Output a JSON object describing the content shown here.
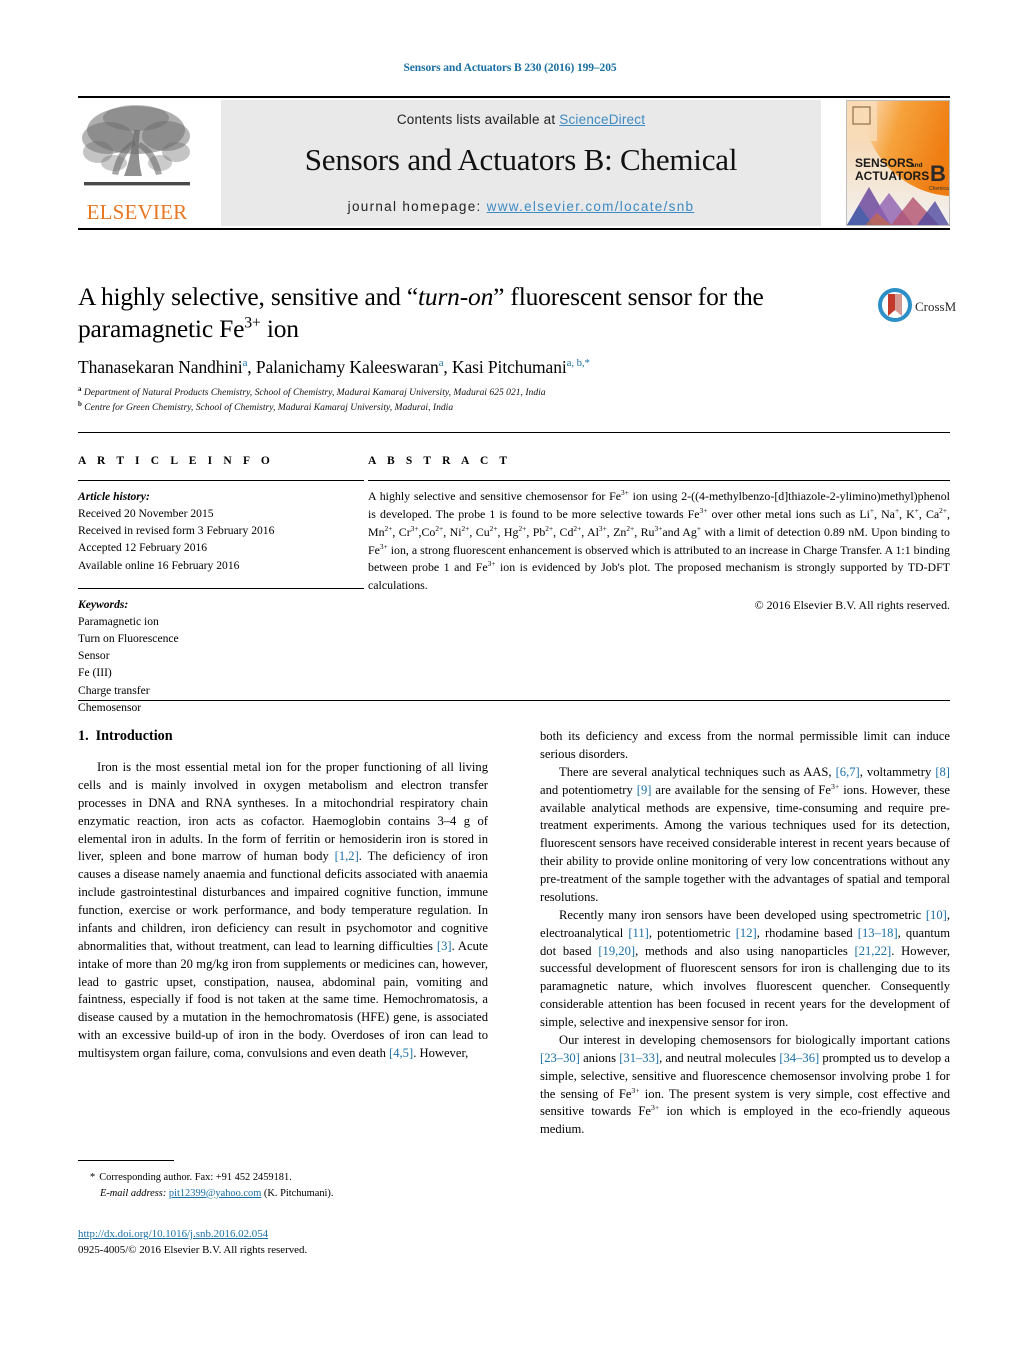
{
  "running_head": "Sensors and Actuators B 230 (2016) 199–205",
  "masthead": {
    "contents_prefix": "Contents lists available at ",
    "sciencedirect": "ScienceDirect",
    "journal_title": "Sensors and Actuators B: Chemical",
    "homepage_prefix": "journal homepage: ",
    "homepage_url": "www.elsevier.com/locate/snb",
    "publisher_wordmark": "ELSEVIER",
    "publisher_logo_name": "elsevier-tree-logo",
    "cover_title_line1": "SENSORS",
    "cover_title_and": "and",
    "cover_title_line2": "ACTUATORS",
    "cover_volume_letter": "B",
    "cover_sub": "Chemical",
    "link_color": "#3D8BC4",
    "brand_orange": "#E87722",
    "band_bg": "#e9e9e9"
  },
  "title": {
    "part1": "A highly selective, sensitive and “",
    "italic": "turn-on",
    "part2": "” fluorescent sensor for the paramagnetic Fe",
    "sup": "3+",
    "part3": " ion"
  },
  "crossmark": {
    "label": "CrossMark",
    "ring_color": "#2d8fc7",
    "inner_color": "#c0392b"
  },
  "authors": [
    {
      "name": "Thanasekaran Nandhini",
      "marks": "a",
      "sep": ", "
    },
    {
      "name": "Palanichamy Kaleeswaran",
      "marks": "a",
      "sep": ", "
    },
    {
      "name": "Kasi Pitchumani",
      "marks": "a, b,",
      "star": "*",
      "sep": ""
    }
  ],
  "affiliations": [
    {
      "mark": "a",
      "text": "Department of Natural Products Chemistry, School of Chemistry, Madurai Kamaraj University, Madurai 625 021, India"
    },
    {
      "mark": "b",
      "text": "Centre for Green Chemistry, School of Chemistry, Madurai Kamaraj University, Madurai, India"
    }
  ],
  "article_info": {
    "heading": "A R T I C L E   I N F O",
    "history_label": "Article history:",
    "history": [
      "Received 20 November 2015",
      "Received in revised form 3 February 2016",
      "Accepted 12 February 2016",
      "Available online 16 February 2016"
    ],
    "keywords_label": "Keywords:",
    "keywords": [
      "Paramagnetic ion",
      "Turn on Fluorescence",
      "Sensor",
      "Fe (III)",
      "Charge transfer",
      "Chemosensor"
    ]
  },
  "abstract": {
    "heading": "A B S T R A C T",
    "body": "A highly selective and sensitive chemosensor for Fe3+ ion using 2-((4-methylbenzo-[d]thiazole-2-ylimino)methyl)phenol is developed. The probe 1 is found to be more selective towards Fe3+ over other metal ions such as Li+, Na+, K+, Ca2+, Mn2+, Cr3+,Co2+, Ni2+, Cu2+, Hg2+, Pb2+, Cd2+, Al3+, Zn2+, Ru3+and Ag+ with a limit of detection 0.89 nM. Upon binding to Fe3+ ion, a strong fluorescent enhancement is observed which is attributed to an increase in Charge Transfer. A 1:1 binding between probe 1 and Fe3+ ion is evidenced by Job's plot. The proposed mechanism is strongly supported by TD-DFT calculations.",
    "copyright": "© 2016 Elsevier B.V. All rights reserved."
  },
  "introduction": {
    "number": "1.",
    "title": "Introduction",
    "left_paragraphs": [
      "Iron is the most essential metal ion for the proper functioning of all living cells and is mainly involved in oxygen metabolism and electron transfer processes in DNA and RNA syntheses. In a mitochondrial respiratory chain enzymatic reaction, iron acts as cofactor. Haemoglobin contains 3–4 g of elemental iron in adults. In the form of ferritin or hemosiderin iron is stored in liver, spleen and bone marrow of human body [1,2]. The deficiency of iron causes a disease namely anaemia and functional deficits associated with anaemia include gastrointestinal disturbances and impaired cognitive function, immune function, exercise or work performance, and body temperature regulation. In infants and children, iron deficiency can result in psychomotor and cognitive abnormalities that, without treatment, can lead to learning difficulties [3]. Acute intake of more than 20 mg/kg iron from supplements or medicines can, however, lead to gastric upset, constipation, nausea, abdominal pain, vomiting and faintness, especially if food is not taken at the same time. Hemochromatosis, a disease caused by a mutation in the hemochromatosis (HFE) gene, is associated with an excessive build-up of iron in the body. Overdoses of iron can lead to multisystem organ failure, coma, convulsions and even death [4,5]. However,"
    ],
    "right_paragraphs": [
      "both its deficiency and excess from the normal permissible limit can induce serious disorders.",
      "There are several analytical techniques such as AAS, [6,7], voltammetry [8] and potentiometry [9] are available for the sensing of Fe3+ ions. However, these available analytical methods are expensive, time-consuming and require pre-treatment experiments. Among the various techniques used for its detection, fluorescent sensors have received considerable interest in recent years because of their ability to provide online monitoring of very low concentrations without any pre-treatment of the sample together with the advantages of spatial and temporal resolutions.",
      "Recently many iron sensors have been developed using spectrometric [10], electroanalytical [11], potentiometric [12], rhodamine based [13–18], quantum dot based [19,20], methods and also using nanoparticles [21,22]. However, successful development of fluorescent sensors for iron is challenging due to its paramagnetic nature, which involves fluorescent quencher. Consequently considerable attention has been focused in recent years for the development of simple, selective and inexpensive sensor for iron.",
      "Our interest in developing chemosensors for biologically important cations [23–30] anions [31–33], and neutral molecules [34–36] prompted us to develop a simple, selective, sensitive and fluorescence chemosensor involving probe 1 for the sensing of Fe3+ ion. The present system is very simple, cost effective and sensitive towards Fe3+ ion which is employed in the eco-friendly aqueous medium."
    ]
  },
  "footnote": {
    "star": "*",
    "corresponding": "Corresponding author. Fax: +91 452 2459181.",
    "email_label": "E-mail address:",
    "email": "pit12399@yahoo.com",
    "email_owner": "(K. Pitchumani)."
  },
  "doi_block": {
    "doi": "http://dx.doi.org/10.1016/j.snb.2016.02.054",
    "issn_line": "0925-4005/© 2016 Elsevier B.V. All rights reserved."
  }
}
